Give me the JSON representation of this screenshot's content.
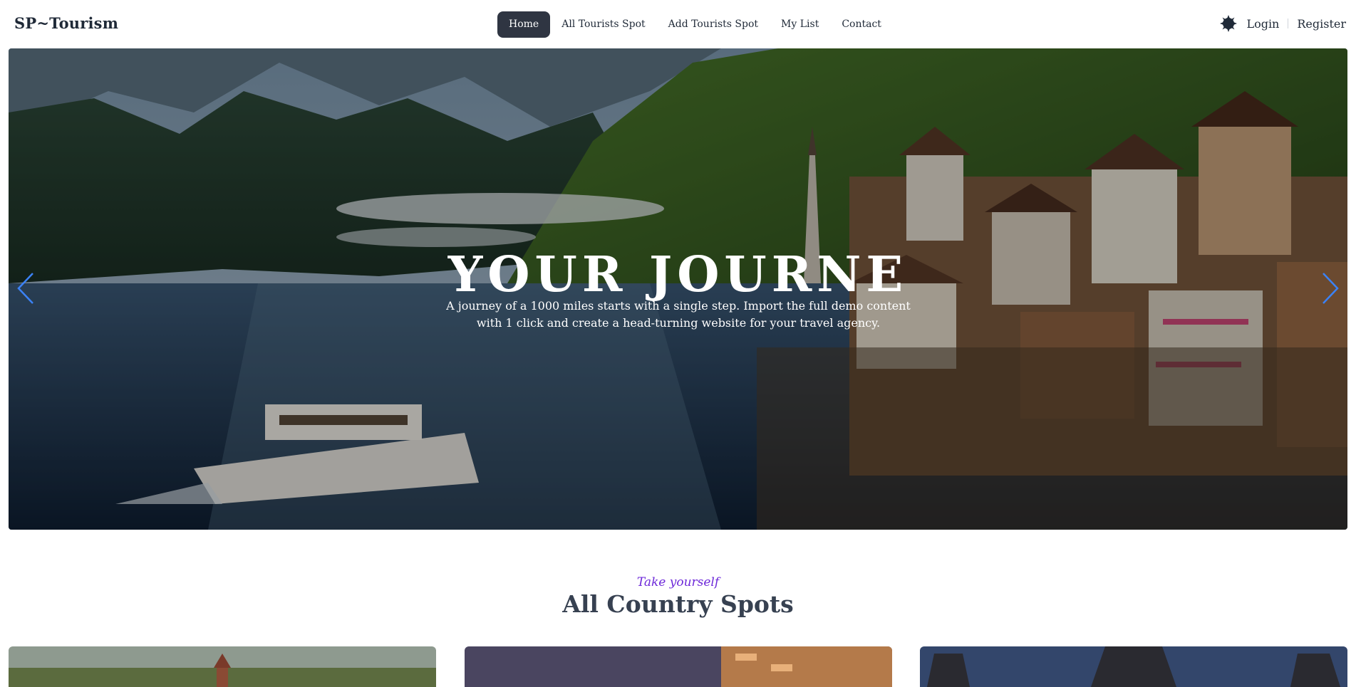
{
  "brand": "SP~Tourism",
  "nav": {
    "links": [
      {
        "label": "Home",
        "active": true
      },
      {
        "label": "All Tourists Spot",
        "active": false
      },
      {
        "label": "Add Tourists Spot",
        "active": false
      },
      {
        "label": "My List",
        "active": false
      },
      {
        "label": "Contact",
        "active": false
      }
    ],
    "theme_icon": "sun-gear-icon",
    "login": "Login",
    "register": "Register"
  },
  "hero": {
    "title": "YOUR JOURNE",
    "subtitle": "A journey of a 1000 miles starts with a single step. Import the full demo content with 1 click and create a head-turning website for your travel agency.",
    "prev_icon": "chevron-left-icon",
    "next_icon": "chevron-right-icon",
    "arrow_color": "#3b82f6"
  },
  "section": {
    "kicker": "Take yourself",
    "title": "All Country Spots"
  },
  "colors": {
    "accent": "#6d28d9",
    "active_nav": "#2f3542"
  }
}
